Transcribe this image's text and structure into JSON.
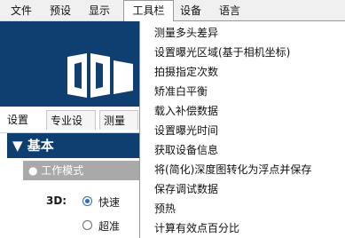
{
  "menubar": {
    "items": [
      {
        "label": "文件"
      },
      {
        "label": "预设"
      },
      {
        "label": "显示"
      },
      {
        "label": "工具栏"
      },
      {
        "label": "设备"
      },
      {
        "label": "语言"
      }
    ]
  },
  "tabs": [
    {
      "label": "设置"
    },
    {
      "label": "专业设置"
    },
    {
      "label": "测量"
    }
  ],
  "section": {
    "title": "▼ 基本"
  },
  "subsection": {
    "title": "● 工作模式"
  },
  "mode": {
    "label": "3D:",
    "options": [
      {
        "label": "快速",
        "checked": true
      },
      {
        "label": "超准",
        "checked": false
      }
    ]
  },
  "toolbar_menu": {
    "items": [
      {
        "label": "测量多头差异"
      },
      {
        "label": "设置曝光区域(基于相机坐标)"
      },
      {
        "label": "拍摄指定次数"
      },
      {
        "label": "矫准白平衡"
      },
      {
        "label": "载入补偿数据"
      },
      {
        "label": "设置曝光时间"
      },
      {
        "label": "获取设备信息"
      },
      {
        "label": "将(简化)深度图转化为浮点并保存"
      },
      {
        "label": "保存调试数据"
      },
      {
        "label": "预热"
      },
      {
        "label": "计算有效点百分比"
      }
    ]
  },
  "colors": {
    "banner": "#0f3e70",
    "section": "#0f3e70",
    "subsection": "#a9a9a9",
    "accent": "#2a6cc6"
  }
}
